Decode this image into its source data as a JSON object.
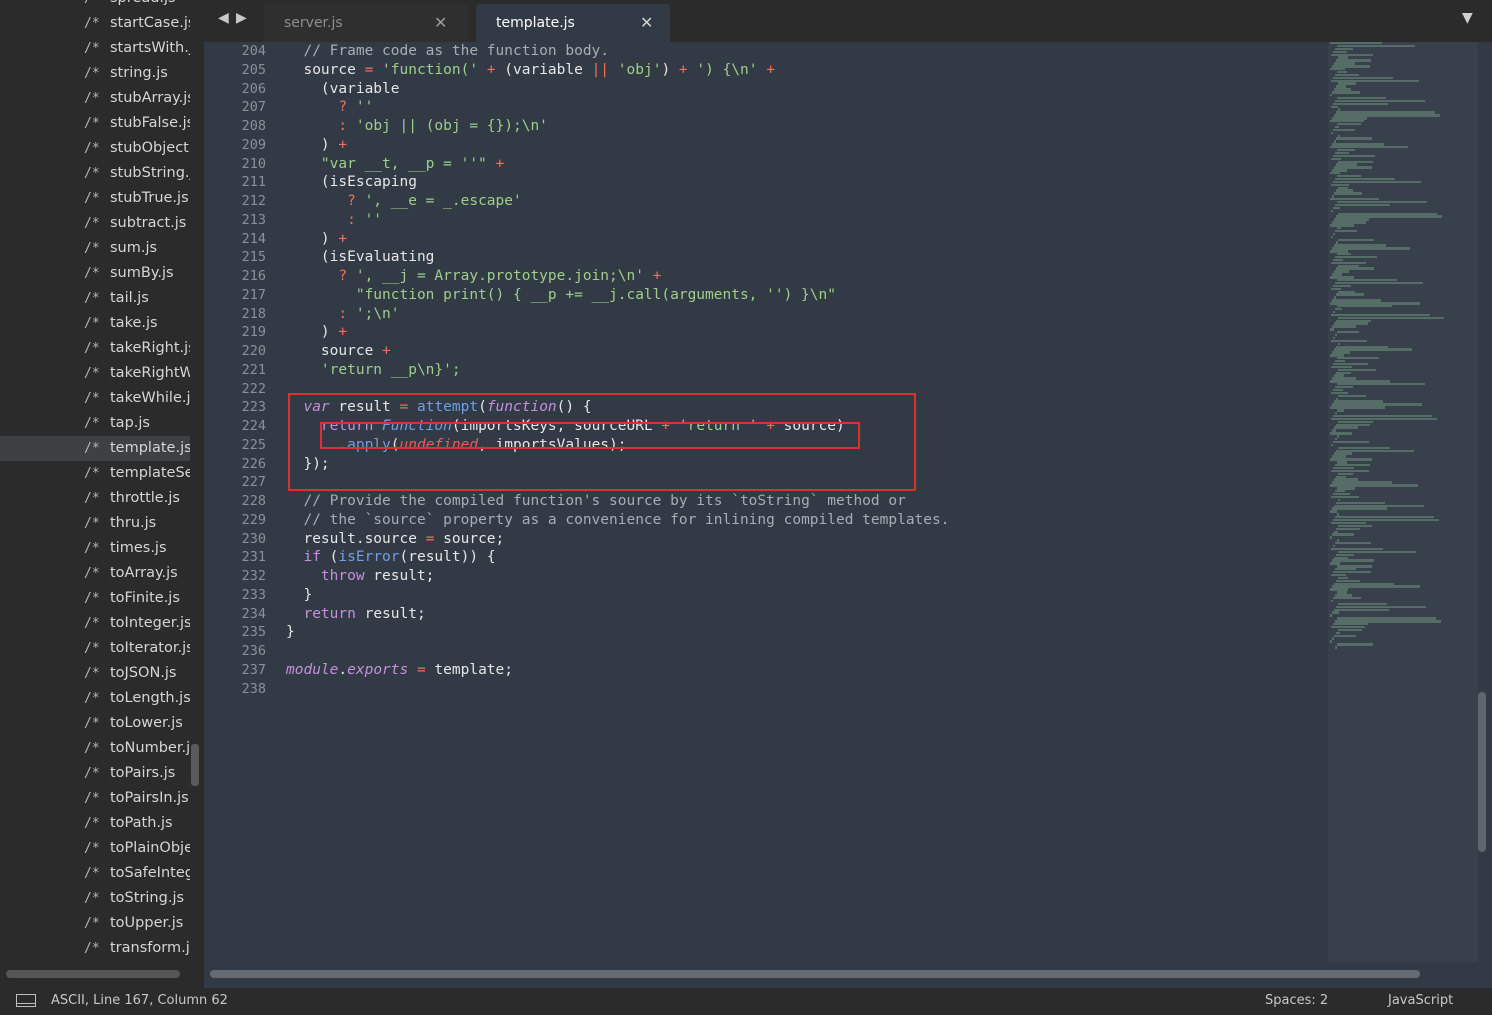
{
  "sidebar": {
    "prefix": "/*",
    "files": [
      "spread.js",
      "startCase.js",
      "startsWith.js",
      "string.js",
      "stubArray.js",
      "stubFalse.js",
      "stubObject.js",
      "stubString.js",
      "stubTrue.js",
      "subtract.js",
      "sum.js",
      "sumBy.js",
      "tail.js",
      "take.js",
      "takeRight.js",
      "takeRightWhile.js",
      "takeWhile.js",
      "tap.js",
      "template.js",
      "templateSettings.js",
      "throttle.js",
      "thru.js",
      "times.js",
      "toArray.js",
      "toFinite.js",
      "toInteger.js",
      "toIterator.js",
      "toJSON.js",
      "toLength.js",
      "toLower.js",
      "toNumber.js",
      "toPairs.js",
      "toPairsIn.js",
      "toPath.js",
      "toPlainObject.js",
      "toSafeInteger.js",
      "toString.js",
      "toUpper.js",
      "transform.js"
    ],
    "active_file": "template.js"
  },
  "tabs": {
    "back_icon": "◀",
    "forward_icon": "▶",
    "items": [
      {
        "label": "server.js",
        "close": "✕"
      },
      {
        "label": "template.js",
        "close": "✕"
      }
    ],
    "overflow_icon": "▼"
  },
  "editor": {
    "line_numbers": [
      "204",
      "205",
      "206",
      "207",
      "208",
      "209",
      "210",
      "211",
      "212",
      "213",
      "214",
      "215",
      "216",
      "217",
      "218",
      "219",
      "220",
      "221",
      "222",
      "223",
      "224",
      "225",
      "226",
      "227",
      "228",
      "229",
      "230",
      "231",
      "232",
      "233",
      "234",
      "235",
      "236",
      "237",
      "238"
    ],
    "code": [
      [
        [
          "  ",
          ""
        ],
        [
          "// Frame code as the function body.",
          "c"
        ]
      ],
      [
        [
          "  source ",
          ""
        ],
        [
          "=",
          "o"
        ],
        [
          " ",
          ""
        ],
        [
          "'function('",
          "s"
        ],
        [
          " ",
          ""
        ],
        [
          "+",
          "o"
        ],
        [
          " (variable ",
          ""
        ],
        [
          "||",
          "o"
        ],
        [
          " ",
          ""
        ],
        [
          "'obj'",
          "s"
        ],
        [
          ") ",
          ""
        ],
        [
          "+",
          "o"
        ],
        [
          " ",
          ""
        ],
        [
          "') {\\n'",
          "s"
        ],
        [
          " ",
          ""
        ],
        [
          "+",
          "o"
        ]
      ],
      [
        [
          "    (variable",
          ""
        ]
      ],
      [
        [
          "      ",
          ""
        ],
        [
          "?",
          "o"
        ],
        [
          " ",
          ""
        ],
        [
          "''",
          "s"
        ]
      ],
      [
        [
          "      ",
          ""
        ],
        [
          ":",
          "o"
        ],
        [
          " ",
          ""
        ],
        [
          "'obj || (obj = {});\\n'",
          "s"
        ]
      ],
      [
        [
          "    ) ",
          ""
        ],
        [
          "+",
          "o"
        ]
      ],
      [
        [
          "    ",
          ""
        ],
        [
          "\"var __t, __p = ''\"",
          "s"
        ],
        [
          " ",
          ""
        ],
        [
          "+",
          "o"
        ]
      ],
      [
        [
          "    (isEscaping",
          ""
        ]
      ],
      [
        [
          "       ",
          ""
        ],
        [
          "?",
          "o"
        ],
        [
          " ",
          ""
        ],
        [
          "', __e = _.escape'",
          "s"
        ]
      ],
      [
        [
          "       ",
          ""
        ],
        [
          ":",
          "o"
        ],
        [
          " ",
          ""
        ],
        [
          "''",
          "s"
        ]
      ],
      [
        [
          "    ) ",
          ""
        ],
        [
          "+",
          "o"
        ]
      ],
      [
        [
          "    (isEvaluating",
          ""
        ]
      ],
      [
        [
          "      ",
          ""
        ],
        [
          "?",
          "o"
        ],
        [
          " ",
          ""
        ],
        [
          "', __j = Array.prototype.join;\\n'",
          "s"
        ],
        [
          " ",
          ""
        ],
        [
          "+",
          "o"
        ]
      ],
      [
        [
          "        ",
          ""
        ],
        [
          "\"function print() { __p += __j.call(arguments, '') }\\n\"",
          "s"
        ]
      ],
      [
        [
          "      ",
          ""
        ],
        [
          ":",
          "o"
        ],
        [
          " ",
          ""
        ],
        [
          "';\\n'",
          "s"
        ]
      ],
      [
        [
          "    ) ",
          ""
        ],
        [
          "+",
          "o"
        ]
      ],
      [
        [
          "    source ",
          ""
        ],
        [
          "+",
          "o"
        ]
      ],
      [
        [
          "    ",
          ""
        ],
        [
          "'return __p\\n}';",
          "s"
        ]
      ],
      [
        [
          "",
          ""
        ]
      ],
      [
        [
          "  ",
          ""
        ],
        [
          "var",
          "ki"
        ],
        [
          " result ",
          ""
        ],
        [
          "=",
          "o"
        ],
        [
          " ",
          ""
        ],
        [
          "attempt",
          "f"
        ],
        [
          "(",
          ""
        ],
        [
          "function",
          "ki"
        ],
        [
          "() {",
          ""
        ]
      ],
      [
        [
          "    ",
          ""
        ],
        [
          "return",
          "k"
        ],
        [
          " ",
          ""
        ],
        [
          "Function",
          "fi"
        ],
        [
          "(importsKeys, sourceURL ",
          ""
        ],
        [
          "+",
          "o"
        ],
        [
          " ",
          ""
        ],
        [
          "'return '",
          "s"
        ],
        [
          " ",
          ""
        ],
        [
          "+",
          "o"
        ],
        [
          " source)",
          ""
        ]
      ],
      [
        [
          "      .",
          ""
        ],
        [
          "apply",
          "f"
        ],
        [
          "(",
          ""
        ],
        [
          "undefined",
          "u"
        ],
        [
          ", importsValues);",
          ""
        ]
      ],
      [
        [
          "  });",
          ""
        ]
      ],
      [
        [
          "",
          ""
        ]
      ],
      [
        [
          "  ",
          ""
        ],
        [
          "// Provide the compiled function's source by its `toString` method or",
          "c"
        ]
      ],
      [
        [
          "  ",
          ""
        ],
        [
          "// the `source` property as a convenience for inlining compiled templates.",
          "c"
        ]
      ],
      [
        [
          "  result.source ",
          ""
        ],
        [
          "=",
          "o"
        ],
        [
          " source;",
          ""
        ]
      ],
      [
        [
          "  ",
          ""
        ],
        [
          "if",
          "k"
        ],
        [
          " (",
          ""
        ],
        [
          "isError",
          "f"
        ],
        [
          "(result)) {",
          ""
        ]
      ],
      [
        [
          "    ",
          ""
        ],
        [
          "throw",
          "k"
        ],
        [
          " result;",
          ""
        ]
      ],
      [
        [
          "  }",
          ""
        ]
      ],
      [
        [
          "  ",
          ""
        ],
        [
          "return",
          "k"
        ],
        [
          " result;",
          ""
        ]
      ],
      [
        [
          "}",
          ""
        ]
      ],
      [
        [
          "",
          ""
        ]
      ],
      [
        [
          "",
          ""
        ],
        [
          "module",
          "ki"
        ],
        [
          ".",
          ""
        ],
        [
          "exports",
          "ki"
        ],
        [
          " ",
          ""
        ],
        [
          "=",
          "o"
        ],
        [
          " template;",
          ""
        ]
      ],
      [
        [
          "",
          ""
        ]
      ]
    ]
  },
  "status": {
    "text": "ASCII, Line 167, Column 62",
    "spaces": "Spaces: 2",
    "syntax": "JavaScript"
  }
}
